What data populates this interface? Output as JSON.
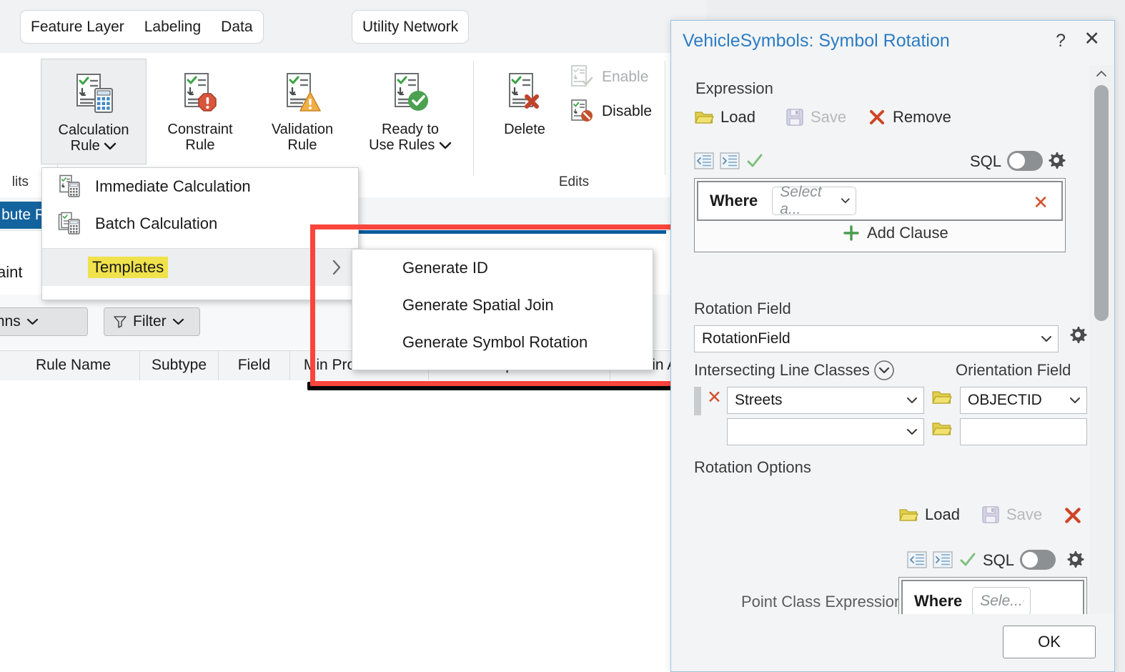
{
  "ribbon": {
    "tab_groups": [
      {
        "tabs": [
          "Feature Layer",
          "Labeling",
          "Data"
        ]
      },
      {
        "tabs": [
          "Utility Network"
        ]
      }
    ],
    "buttons": [
      {
        "id": "calculation-rule",
        "label_line1": "Calculation",
        "label_line2": "Rule",
        "has_dropdown": true,
        "icon": "calculation-rule-icon",
        "state": "active"
      },
      {
        "id": "constraint-rule",
        "label_line1": "Constraint",
        "label_line2": "Rule",
        "has_dropdown": false,
        "icon": "constraint-rule-icon"
      },
      {
        "id": "validation-rule",
        "label_line1": "Validation",
        "label_line2": "Rule",
        "has_dropdown": false,
        "icon": "validation-rule-icon"
      },
      {
        "id": "ready-to-use-rules",
        "label_line1": "Ready to",
        "label_line2": "Use Rules",
        "has_dropdown": true,
        "icon": "ready-to-use-rules-icon"
      },
      {
        "id": "delete",
        "label_line1": "Delete",
        "label_line2": "",
        "has_dropdown": false,
        "icon": "delete-rule-icon"
      }
    ],
    "small_buttons": [
      {
        "id": "enable",
        "label": "Enable",
        "icon": "enable-rule-icon",
        "disabled": true
      },
      {
        "id": "disable",
        "label": "Disable",
        "icon": "disable-rule-icon",
        "disabled": false
      }
    ],
    "group_labels": {
      "edits": "Edits",
      "left_partial": "lits"
    }
  },
  "menu": {
    "items": [
      {
        "label": "Immediate Calculation",
        "icon": "immediate-calculation-icon"
      },
      {
        "label": "Batch Calculation",
        "icon": "batch-calculation-icon"
      }
    ],
    "templates": {
      "label": "Templates",
      "highlight_color": "#f0e24b",
      "submenu_arrow": "chevron-right-icon"
    },
    "submenu": {
      "items": [
        "Generate ID",
        "Generate Spatial Join",
        "Generate Symbol Rotation"
      ]
    }
  },
  "workspace": {
    "tab_partial_label": "bute R",
    "constraint_partial_label": "aint",
    "toolbar": {
      "columns_label": "olumns",
      "filter_label": "Filter",
      "filter_icon": "filter-icon"
    },
    "table": {
      "columns": [
        "Rule Name",
        "Subtype",
        "Field",
        "Min Pro Release",
        "Min Enterprise Release",
        "Min A"
      ],
      "rows": []
    }
  },
  "annotation": {
    "rect_color": "#f9453c"
  },
  "dialog": {
    "title": "VehicleSymbols: Symbol Rotation",
    "help_icon": "?",
    "close_icon": "✕",
    "expression": {
      "section_label": "Expression",
      "actions": [
        {
          "label": "Load",
          "icon": "folder-open-icon",
          "disabled": false
        },
        {
          "label": "Save",
          "icon": "floppy-disk-icon",
          "disabled": true
        },
        {
          "label": "Remove",
          "icon": "x-mark-icon",
          "disabled": false
        }
      ],
      "toolbar": {
        "outdent_icon": "outdent-icon",
        "indent_icon": "indent-icon",
        "validate_icon": "check-icon",
        "sql_label": "SQL",
        "sql_enabled": false,
        "settings_icon": "gear-icon"
      },
      "clause": {
        "where_label": "Where",
        "field_placeholder": "Select a...",
        "remove_icon": "x-mark-icon"
      },
      "add_clause_label": "Add Clause",
      "add_clause_icon": "plus-icon"
    },
    "rotation_field": {
      "label": "Rotation Field",
      "value": "RotationField",
      "settings_icon": "gear-icon"
    },
    "intersecting_line_classes": {
      "label": "Intersecting Line Classes",
      "collapse_icon": "chevron-down-circle-icon",
      "orientation_field_label": "Orientation Field",
      "rows": [
        {
          "line_class": "Streets",
          "orientation_field": "OBJECTID",
          "remove_icon": "x-mark-icon",
          "browse_icon": "folder-open-icon"
        },
        {
          "line_class": "",
          "orientation_field": "",
          "remove_icon": "",
          "browse_icon": "folder-open-icon"
        }
      ]
    },
    "rotation_options": {
      "label": "Rotation Options",
      "actions": [
        {
          "label": "Load",
          "icon": "folder-open-icon",
          "disabled": false
        },
        {
          "label": "Save",
          "icon": "floppy-disk-icon",
          "disabled": true
        },
        {
          "label": "",
          "icon": "x-mark-icon",
          "disabled": false
        }
      ],
      "toolbar": {
        "outdent_icon": "outdent-icon",
        "indent_icon": "indent-icon",
        "validate_icon": "check-icon",
        "sql_label": "SQL",
        "sql_enabled": false,
        "settings_icon": "gear-icon"
      },
      "point_class_expression_label": "Point Class Expression",
      "clause": {
        "where_label": "Where",
        "field_placeholder": "Sele..."
      }
    },
    "footer": {
      "ok_label": "OK"
    },
    "scrollbar": {
      "up_icon": "chevron-up-icon",
      "down_icon": "chevron-down-icon"
    }
  }
}
